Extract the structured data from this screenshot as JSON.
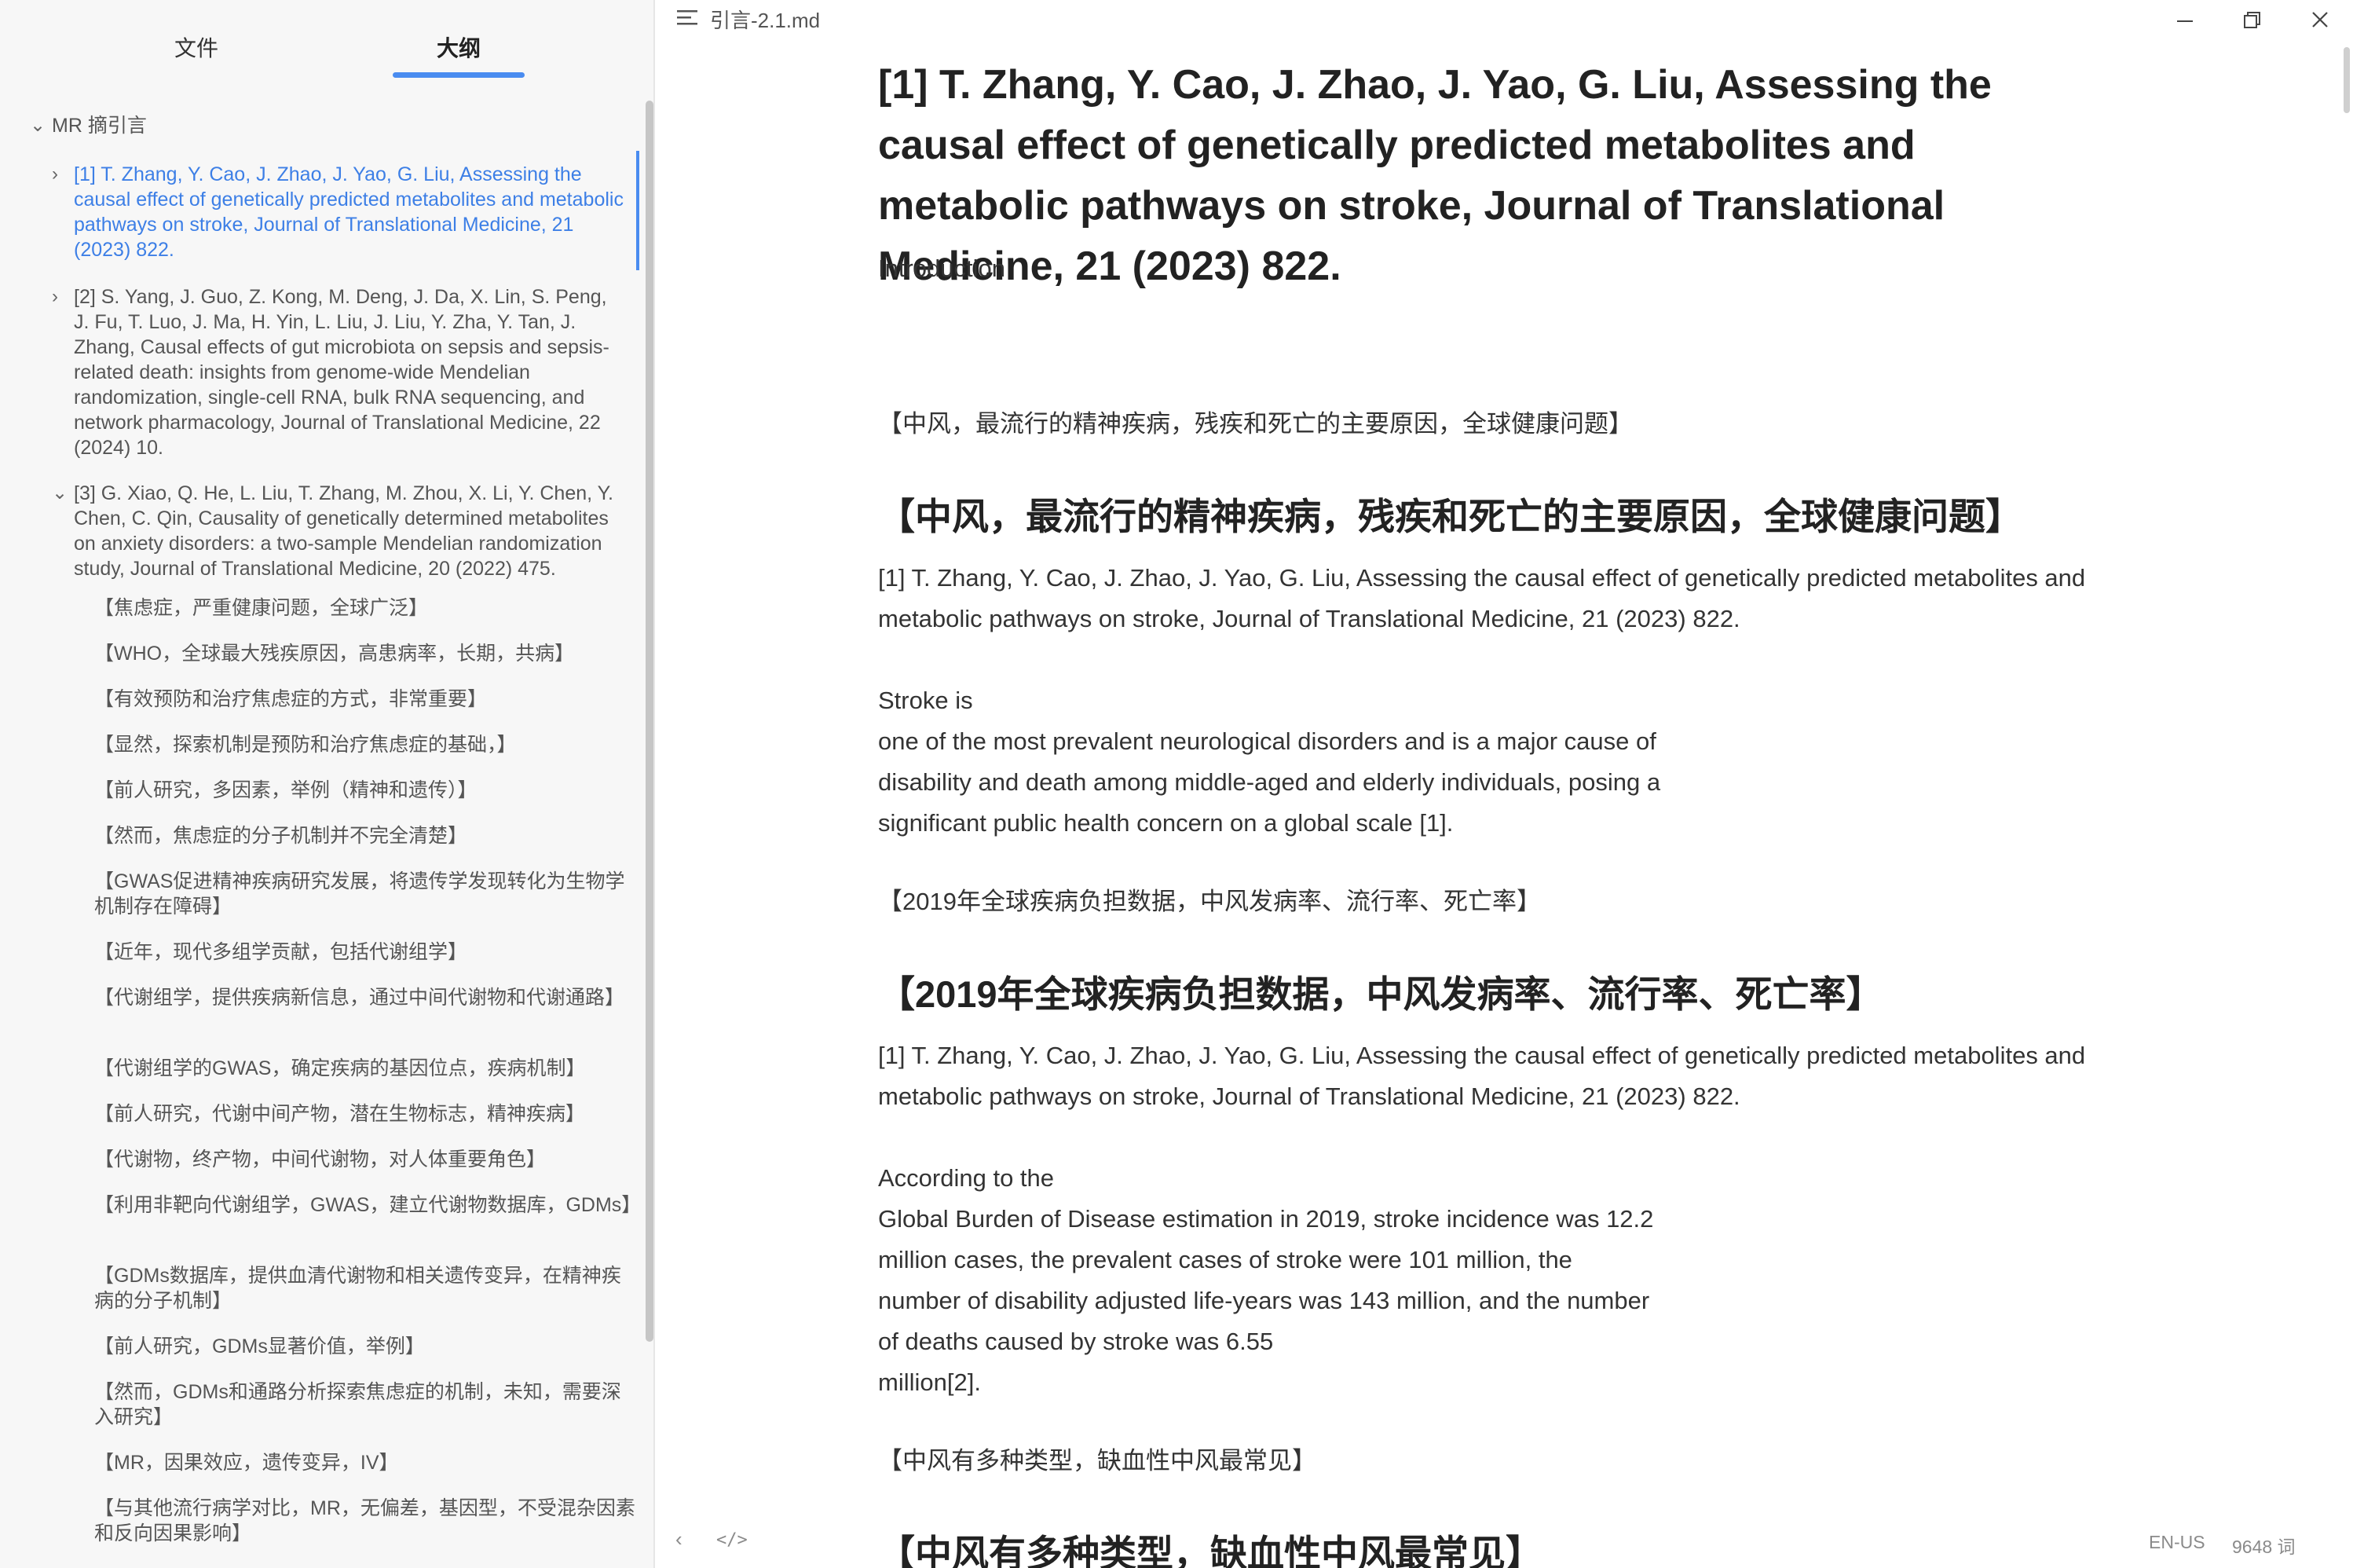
{
  "sidebar": {
    "tabs": {
      "files": "文件",
      "outline": "大纲"
    },
    "root": "MR 摘引言",
    "refs": [
      "[1] T. Zhang, Y. Cao, J. Zhao, J. Yao, G. Liu, Assessing the causal effect of genetically predicted metabolites and metabolic pathways on stroke, Journal of Translational Medicine, 21 (2023) 822.",
      "[2] S. Yang, J. Guo, Z. Kong, M. Deng, J. Da, X. Lin, S. Peng, J. Fu, T. Luo, J. Ma, H. Yin, L. Liu, J. Liu, Y. Zha, Y. Tan, J. Zhang, Causal effects of gut microbiota on sepsis and sepsis-related death: insights from genome-wide Mendelian randomization, single-cell RNA, bulk RNA sequencing, and network pharmacology, Journal of Translational Medicine, 22 (2024) 10.",
      "[3] G. Xiao, Q. He, L. Liu, T. Zhang, M. Zhou, X. Li, Y. Chen, Y. Chen, C. Qin, Causality of genetically determined metabolites on anxiety disorders: a two-sample Mendelian randomization study, Journal of Translational Medicine, 20 (2022) 475."
    ],
    "subs": [
      "【焦虑症，严重健康问题，全球广泛】",
      "【WHO，全球最大残疾原因，高患病率，长期，共病】",
      "【有效预防和治疗焦虑症的方式，非常重要】",
      "【显然，探索机制是预防和治疗焦虑症的基础，】",
      "【前人研究，多因素，举例（精神和遗传）】",
      "【然而，焦虑症的分子机制并不完全清楚】",
      "【GWAS促进精神疾病研究发展，将遗传学发现转化为生物学机制存在障碍】",
      "【近年，现代多组学贡献，包括代谢组学】",
      "【代谢组学，提供疾病新信息，通过中间代谢物和代谢通路】",
      "【代谢组学的GWAS，确定疾病的基因位点，疾病机制】",
      "【前人研究，代谢中间产物，潜在生物标志，精神疾病】",
      "【代谢物，终产物，中间代谢物，对人体重要角色】",
      "【利用非靶向代谢组学，GWAS，建立代谢物数据库，GDMs】",
      "【GDMs数据库，提供血清代谢物和相关遗传变异，在精神疾病的分子机制】",
      "【前人研究，GDMs显著价值，举例】",
      "【然而，GDMs和通路分析探索焦虑症的机制，未知，需要深入研究】",
      "【MR，因果效应，遗传变异，IV】",
      "【与其他流行病学对比，MR，无偏差，基因型，不受混杂因素和反向因果影响】"
    ]
  },
  "topbar": {
    "title": "引言-2.1.md"
  },
  "document": {
    "h1": "[1] T. Zhang, Y. Cao, J. Zhao, J. Yao, G. Liu, Assessing the causal effect of genetically predicted metabolites and metabolic pathways on stroke, Journal of Translational Medicine, 21 (2023) 822.",
    "intro": "Introduction",
    "note1": "【中风，最流行的精神疾病，残疾和死亡的主要原因，全球健康问题】",
    "h2_1": "【中风，最流行的精神疾病，残疾和死亡的主要原因，全球健康问题】",
    "cite1": "[1] T. Zhang, Y. Cao, J. Zhao, J. Yao, G. Liu, Assessing the causal effect of genetically predicted metabolites and metabolic pathways on stroke, Journal of Translational Medicine, 21 (2023) 822.",
    "para1": [
      "Stroke is",
      "one of the most prevalent neurological disorders and is a major cause of",
      "disability and death among middle-aged and elderly individuals, posing a",
      "significant public health concern on a global scale [1]."
    ],
    "note2": "【2019年全球疾病负担数据，中风发病率、流行率、死亡率】",
    "h2_2": "【2019年全球疾病负担数据，中风发病率、流行率、死亡率】",
    "cite2": "[1] T. Zhang, Y. Cao, J. Zhao, J. Yao, G. Liu, Assessing the causal effect of genetically predicted metabolites and metabolic pathways on stroke, Journal of Translational Medicine, 21 (2023) 822.",
    "para2": [
      "According to the",
      "Global Burden of Disease estimation in 2019, stroke incidence was 12.2",
      "million cases, the prevalent cases of stroke were 101 million, the",
      "number of disability adjusted life-years was 143 million, and the number",
      "of deaths caused by stroke was 6.55",
      "million[2]."
    ],
    "note3": "【中风有多种类型，缺血性中风最常见】",
    "h2_3": "【中风有多种类型，缺血性中风最常见】"
  },
  "statusbar": {
    "lang": "EN-US",
    "words": "9648 词"
  },
  "colors": {
    "accent": "#4a8cf0",
    "active_text": "#3d7fe6",
    "sidebar_bg": "#f7f7f7"
  },
  "icons": [
    "menu-icon",
    "minimize-icon",
    "restore-icon",
    "close-icon",
    "chevron-right-icon",
    "chevron-down-icon",
    "back-arrow-icon",
    "source-code-icon"
  ]
}
